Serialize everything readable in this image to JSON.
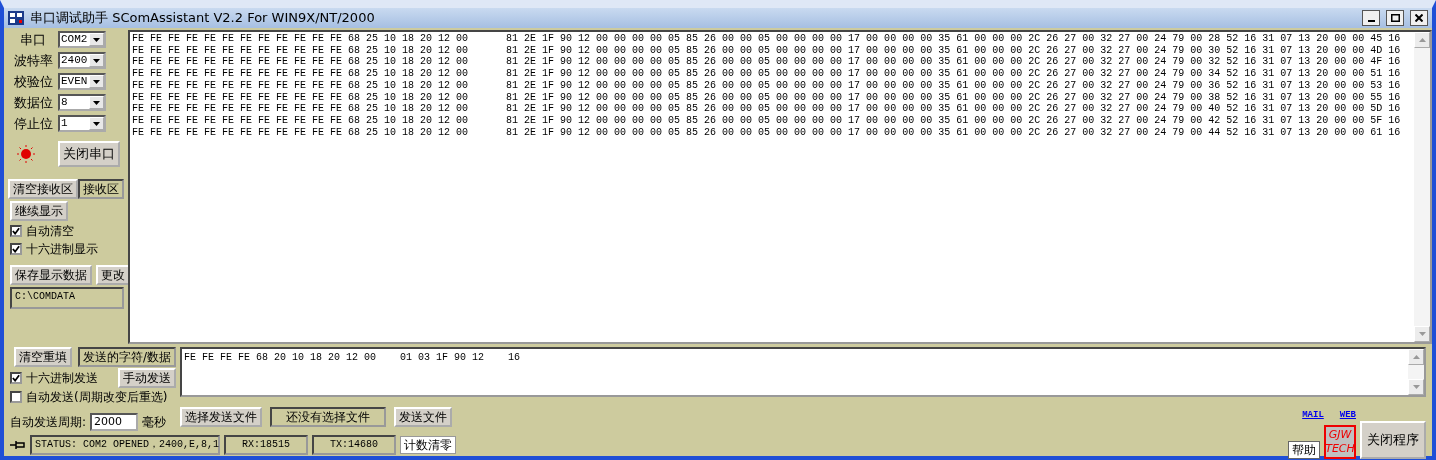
{
  "window": {
    "title": "串口调试助手 SComAssistant V2.2 For WIN9X/NT/2000"
  },
  "port_settings": [
    {
      "label": "串口",
      "value": "COM2"
    },
    {
      "label": "波特率",
      "value": "2400"
    },
    {
      "label": "校验位",
      "value": "EVEN"
    },
    {
      "label": "数据位",
      "value": "8"
    },
    {
      "label": "停止位",
      "value": "1"
    }
  ],
  "port_lamp": {
    "on": true
  },
  "port_button": "关闭串口",
  "receive_controls": {
    "clear_button": "清空接收区",
    "area_label": "接收区",
    "continue_button": "继续显示",
    "options": [
      {
        "label": "自动清空",
        "checked": true
      },
      {
        "label": "十六进制显示",
        "checked": true
      }
    ],
    "save_button": "保存显示数据",
    "change_button": "更改",
    "save_path": "C:\\COMDATA"
  },
  "receive": {
    "lines": [
      {
        "start": "FE FE FE FE FE FE FE FE FE FE FE FE 68 25 10 18 20 12 00",
        "end": "81 2E 1F 90 12 00 00 00 00 05 85 26 00 00 05 00 00 00 00 17 00 00 00 00 35 61 00 00 00 2C 26 27 00 32 27 00 24 79 00 28 52 16 31 07 13 20 00 00 45 16"
      },
      {
        "start": "FE FE FE FE FE FE FE FE FE FE FE FE 68 25 10 18 20 12 00",
        "end": "81 2E 1F 90 12 00 00 00 00 05 85 26 00 00 05 00 00 00 00 17 00 00 00 00 35 61 00 00 00 2C 26 27 00 32 27 00 24 79 00 30 52 16 31 07 13 20 00 00 4D 16"
      },
      {
        "start": "FE FE FE FE FE FE FE FE FE FE FE FE 68 25 10 18 20 12 00",
        "end": "81 2E 1F 90 12 00 00 00 00 05 85 26 00 00 05 00 00 00 00 17 00 00 00 00 35 61 00 00 00 2C 26 27 00 32 27 00 24 79 00 32 52 16 31 07 13 20 00 00 4F 16"
      },
      {
        "start": "FE FE FE FE FE FE FE FE FE FE FE FE 68 25 10 18 20 12 00",
        "end": "81 2E 1F 90 12 00 00 00 00 05 85 26 00 00 05 00 00 00 00 17 00 00 00 00 35 61 00 00 00 2C 26 27 00 32 27 00 24 79 00 34 52 16 31 07 13 20 00 00 51 16"
      },
      {
        "start": "FE FE FE FE FE FE FE FE FE FE FE FE 68 25 10 18 20 12 00",
        "end": "81 2E 1F 90 12 00 00 00 00 05 85 26 00 00 05 00 00 00 00 17 00 00 00 00 35 61 00 00 00 2C 26 27 00 32 27 00 24 79 00 36 52 16 31 07 13 20 00 00 53 16"
      },
      {
        "start": "FE FE FE FE FE FE FE FE FE FE FE FE 68 25 10 18 20 12 00",
        "end": "81 2E 1F 90 12 00 00 00 00 05 85 26 00 00 05 00 00 00 00 17 00 00 00 00 35 61 00 00 00 2C 26 27 00 32 27 00 24 79 00 38 52 16 31 07 13 20 00 00 55 16"
      },
      {
        "start": "FE FE FE FE FE FE FE FE FE FE FE FE 68 25 10 18 20 12 00",
        "end": "81 2E 1F 90 12 00 00 00 00 05 85 26 00 00 05 00 00 00 00 17 00 00 00 00 35 61 00 00 00 2C 26 27 00 32 27 00 24 79 00 40 52 16 31 07 13 20 00 00 5D 16"
      },
      {
        "start": "FE FE FE FE FE FE FE FE FE FE FE FE 68 25 10 18 20 12 00",
        "end": "81 2E 1F 90 12 00 00 00 00 05 85 26 00 00 05 00 00 00 00 17 00 00 00 00 35 61 00 00 00 2C 26 27 00 32 27 00 24 79 00 42 52 16 31 07 13 20 00 00 5F 16"
      },
      {
        "start": "FE FE FE FE FE FE FE FE FE FE FE FE 68 25 10 18 20 12 00",
        "end": "81 2E 1F 90 12 00 00 00 00 05 85 26 00 00 05 00 00 00 00 17 00 00 00 00 35 61 00 00 00 2C 26 27 00 32 27 00 24 79 00 44 52 16 31 07 13 20 00 00 61 16"
      }
    ]
  },
  "send_controls": {
    "clear_button": "清空重填",
    "area_label": "发送的字符/数据",
    "options": [
      {
        "label": "十六进制发送",
        "checked": true
      },
      {
        "label": "自动发送(周期改变后重选)",
        "checked": false
      }
    ],
    "manual_button": "手动发送",
    "period_label": "自动发送周期:",
    "period_value": "2000",
    "period_unit": "毫秒"
  },
  "send": {
    "segments": [
      "FE FE FE FE 68 20 10 18 20 12 00",
      "01 03 1F 90 12",
      "16"
    ]
  },
  "file": {
    "select_button": "选择发送文件",
    "file_name": "还没有选择文件",
    "send_button": "发送文件"
  },
  "status_bar": {
    "status": "STATUS: COM2 OPENED，2400,E,8,1",
    "rx": "RX:18515",
    "tx": "TX:14680",
    "reset_button": "计数清零"
  },
  "links": [
    "MAIL",
    "WEB"
  ],
  "help_button": "帮助",
  "logo": [
    "GJW",
    "TECH"
  ],
  "close_button": "关闭程序"
}
